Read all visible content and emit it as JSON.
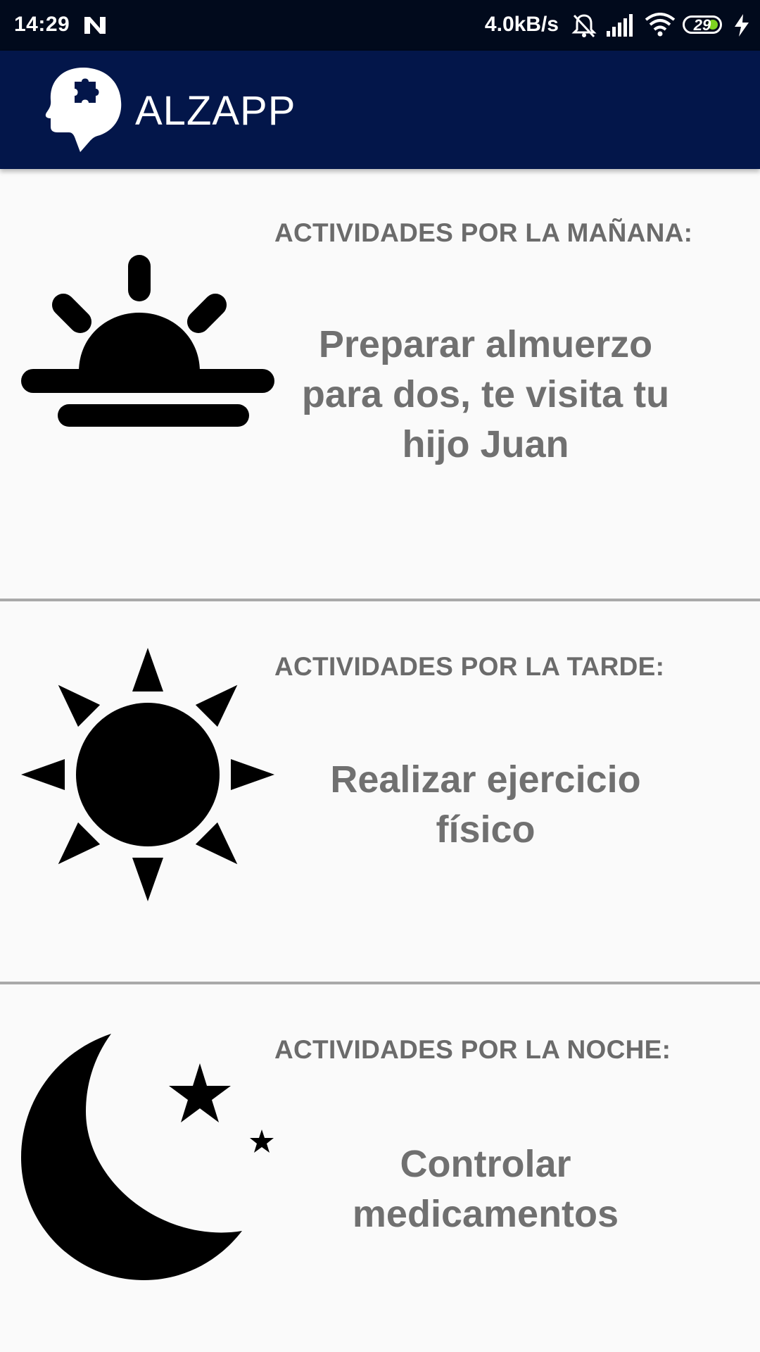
{
  "status_bar": {
    "time": "14:29",
    "net_speed": "4.0kB/s",
    "battery_level": "29",
    "icons": [
      "n-notification-icon",
      "mute-alarm-icon",
      "signal-icon",
      "wifi-icon",
      "battery-icon",
      "charging-icon"
    ]
  },
  "app_bar": {
    "title": "ALZAPP",
    "logo_icon": "head-puzzle-icon",
    "background": "#03164a"
  },
  "sections": [
    {
      "header": "ACTIVIDADES POR LA MAÑANA:",
      "text": "Preparar almuerzo para dos, te visita tu hijo Juan",
      "icon": "sunrise-icon"
    },
    {
      "header": "ACTIVIDADES POR LA TARDE:",
      "text": "Realizar ejercicio físico",
      "icon": "sun-icon"
    },
    {
      "header": "ACTIVIDADES POR LA NOCHE:",
      "text": "Controlar medicamentos",
      "icon": "moon-stars-icon"
    }
  ],
  "colors": {
    "status_bar": "#010a1c",
    "divider": "#a9a9a9",
    "text": "#707070",
    "background": "#fafafa"
  }
}
